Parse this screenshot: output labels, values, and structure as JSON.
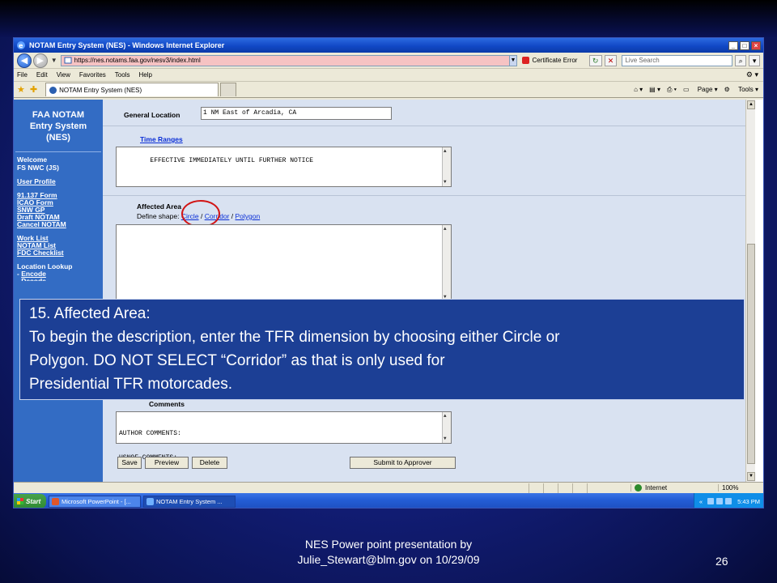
{
  "window": {
    "title": "NOTAM Entry System (NES) - Windows Internet Explorer",
    "url": "https://nes.notams.faa.gov/nesv3/index.html",
    "cert_error": "Certificate Error",
    "search_placeholder": "Live Search"
  },
  "menu": [
    "File",
    "Edit",
    "View",
    "Favorites",
    "Tools",
    "Help"
  ],
  "tab": {
    "label": "NOTAM Entry System (NES)"
  },
  "command_bar": {
    "page": "Page",
    "tools": "Tools"
  },
  "sidebar": {
    "brand": [
      "FAA NOTAM",
      "Entry System",
      "(NES)"
    ],
    "welcome": "Welcome",
    "user": "FS NWC (JS)",
    "user_profile": "User Profile",
    "forms": [
      "91.137 Form",
      "ICAO Form",
      "SNW GP",
      "Draft NOTAM",
      "Cancel NOTAM"
    ],
    "lists": [
      "Work List",
      "NOTAM List",
      "FDC Checklist"
    ],
    "location_lookup": "Location Lookup",
    "encode_prefix": "- ",
    "encode": "Encode",
    "decode_partial": "- Decode"
  },
  "form": {
    "general_location_label": "General Location",
    "general_location_value": "1 NM East of Arcadia, CA",
    "time_ranges_link": "Time Ranges",
    "time_ranges_value": "EFFECTIVE IMMEDIATELY UNTIL FURTHER NOTICE",
    "affected_area_label": "Affected Area",
    "define_shape_label": "Define shape:",
    "shape_circle": "Circle",
    "shape_corridor": "Corridor",
    "shape_polygon": "Polygon",
    "shape_sep": "/",
    "comments_label": "Comments",
    "comments_line1": "AUTHOR COMMENTS:",
    "comments_line2": "USNOF COMMENTS:",
    "buttons": {
      "save": "Save",
      "preview": "Preview",
      "delete": "Delete",
      "submit": "Submit to Approver"
    }
  },
  "status": {
    "zone": "Internet",
    "zoom": "100%"
  },
  "taskbar": {
    "start": "Start",
    "tasks": [
      "Microsoft PowerPoint - [...",
      "NOTAM Entry System ..."
    ],
    "time": "5:43 PM"
  },
  "callout": {
    "line1": "15.  Affected Area:",
    "line2": "To begin the description, enter the TFR dimension by choosing either Circle or",
    "line3": "Polygon.   DO NOT SELECT “Corridor” as that is only used for",
    "line4": "Presidential TFR motorcades."
  },
  "footer": {
    "line1": "NES Power point presentation by",
    "line2": "Julie_Stewart@blm.gov on 10/29/09",
    "page": "26"
  },
  "colors": {
    "slide_bg": "#142080",
    "sidebar": "#336cc4",
    "callout_bg": "#1c3f95",
    "highlight_ring": "#d21515"
  }
}
